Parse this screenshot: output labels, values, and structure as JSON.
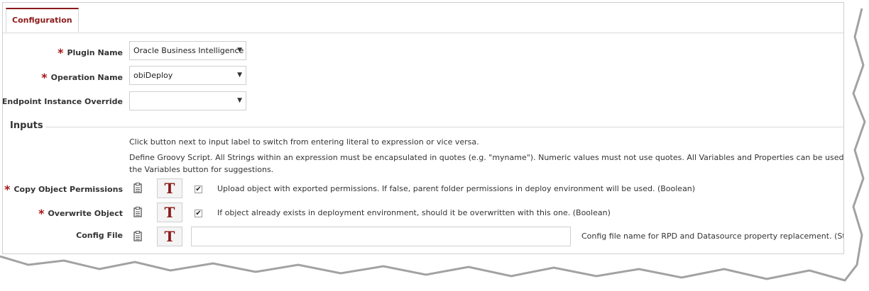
{
  "tabs": [
    {
      "label": "Configuration"
    }
  ],
  "form": {
    "plugin_name": {
      "label": "Plugin Name",
      "value": "Oracle Business Intelligence",
      "required": true
    },
    "operation_name": {
      "label": "Operation Name",
      "value": "obiDeploy",
      "required": true
    },
    "endpoint_override": {
      "label": "Endpoint Instance Override",
      "value": "",
      "required": false
    }
  },
  "inputs": {
    "title": "Inputs",
    "help1": "Click button next to input label to switch from entering literal to expression or vice versa.",
    "help2a": "Define Groovy Script. All Strings within an expression must be encapsulated in quotes (e.g. \"myname\"). Numeric values must not use quotes. All Variables and Properties can be used directly (e.g. MY_VAR). E",
    "help2b": "the Variables button for suggestions.",
    "t_label": "T",
    "fields": [
      {
        "label": "Copy Object Permissions",
        "required": true,
        "checked": true,
        "description": "Upload object with exported permissions. If false, parent folder permissions in deploy environment will be used. (Boolean)"
      },
      {
        "label": "Overwrite Object",
        "required": true,
        "checked": true,
        "description": "If object already exists in deployment environment, should it be overwritten with this one. (Boolean)"
      },
      {
        "label": "Config File",
        "required": false,
        "value": "",
        "description": "Config file name for RPD and Datasource property replacement. (String)"
      }
    ]
  },
  "required_marker": "*",
  "icons": {
    "clipboard": "clipboard-icon",
    "dropdown": "chevron-down-icon",
    "check": "checkmark-icon"
  },
  "colors": {
    "accent": "#8b1a1a",
    "required": "#a31515",
    "border": "#cfcfcf"
  }
}
